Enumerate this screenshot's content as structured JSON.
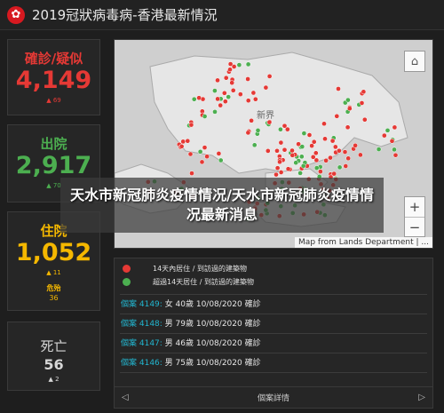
{
  "header": {
    "title": "2019冠狀病毒病-香港最新情況",
    "emblem_glyph": "✿",
    "emblem_color": "#d71920"
  },
  "cards": [
    {
      "title": "確診/疑似",
      "value": "4,149",
      "delta": "▲ 69",
      "color": "#e53935"
    },
    {
      "title": "出院",
      "value": "2,917",
      "delta": "▲ 70",
      "color": "#4caf50"
    },
    {
      "title": "住院",
      "value": "1,052",
      "delta": "▲ 11",
      "sub_label": "危殆",
      "sub_value": "36",
      "color": "#f5b800"
    },
    {
      "title": "死亡",
      "value": "56",
      "delta": "▲ 2",
      "color": "#d6d6d6"
    }
  ],
  "map": {
    "attribution": "Map from Lands Department | ...",
    "place_label": "新界",
    "home_icon": "home-icon",
    "zoom_in": "+",
    "zoom_out": "−"
  },
  "legend": {
    "recent": "14天內居住 / 到訪過的建築物",
    "recent_color": "#e53935",
    "older": "超過14天居住 / 到訪過的建築物",
    "older_color": "#4caf50"
  },
  "cases": [
    {
      "id": "個案 4149:",
      "details": " 女  40歲  10/08/2020 確診"
    },
    {
      "id": "個案 4148:",
      "details": " 男  79歲  10/08/2020 確診"
    },
    {
      "id": "個案 4147:",
      "details": " 男  46歲  10/08/2020 確診"
    },
    {
      "id": "個案 4146:",
      "details": " 男  75歲  10/08/2020 確診"
    }
  ],
  "footer": {
    "label": "個案詳情",
    "prev": "◁",
    "next": "▷"
  },
  "banner": {
    "text": "天水市新冠肺炎疫情情况/天水市新冠肺炎疫情情况最新消息"
  }
}
